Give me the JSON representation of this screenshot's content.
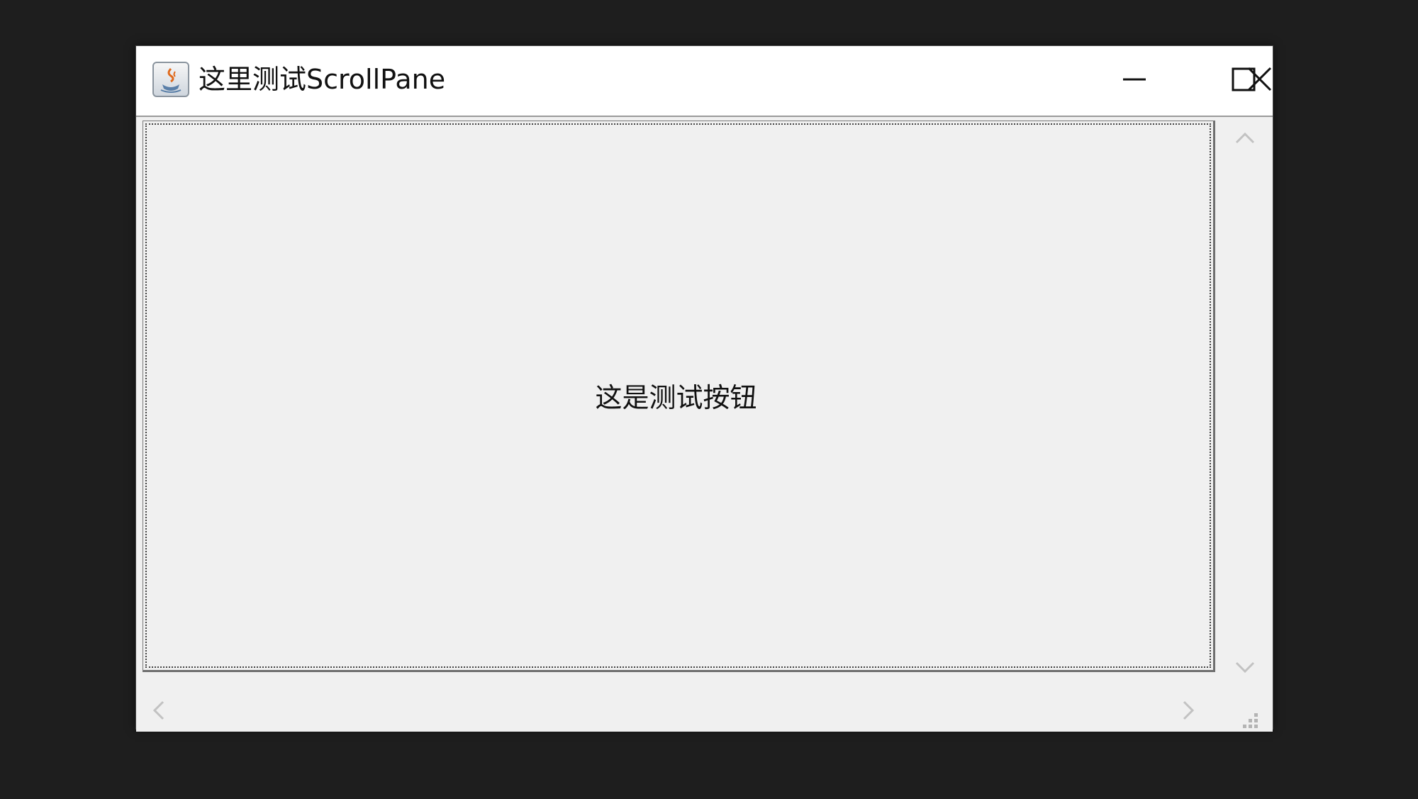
{
  "window": {
    "title": "这里测试ScrollPane",
    "icon": "java-cup-icon",
    "controls": {
      "minimize": "minimize-icon",
      "maximize": "maximize-icon",
      "close": "close-icon"
    }
  },
  "content": {
    "button_label": "这是测试按钮"
  },
  "scrollbars": {
    "vertical": {
      "up": "chevron-up-icon",
      "down": "chevron-down-icon"
    },
    "horizontal": {
      "left": "chevron-left-icon",
      "right": "chevron-right-icon"
    },
    "grip": "resize-grip-icon"
  },
  "colors": {
    "desktop": "#1e1e1e",
    "titlebar": "#ffffff",
    "client": "#f0f0f0"
  }
}
